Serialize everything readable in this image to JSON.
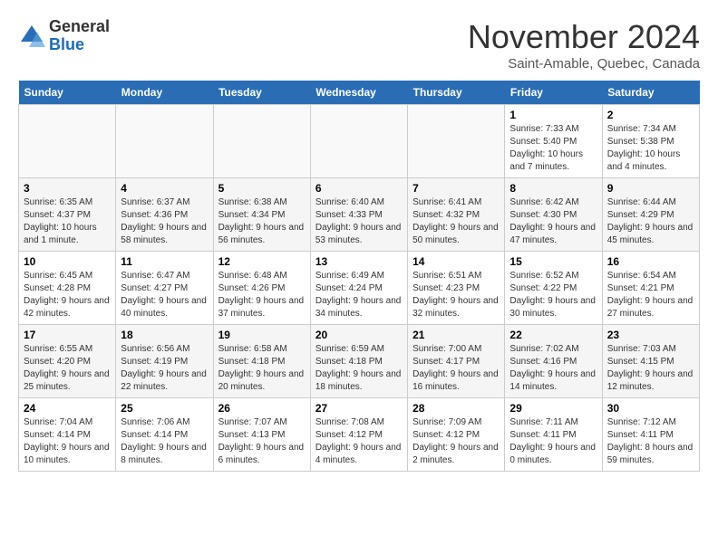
{
  "logo": {
    "line1": "General",
    "line2": "Blue"
  },
  "title": "November 2024",
  "subtitle": "Saint-Amable, Quebec, Canada",
  "weekdays": [
    "Sunday",
    "Monday",
    "Tuesday",
    "Wednesday",
    "Thursday",
    "Friday",
    "Saturday"
  ],
  "weeks": [
    [
      {
        "day": "",
        "info": ""
      },
      {
        "day": "",
        "info": ""
      },
      {
        "day": "",
        "info": ""
      },
      {
        "day": "",
        "info": ""
      },
      {
        "day": "",
        "info": ""
      },
      {
        "day": "1",
        "info": "Sunrise: 7:33 AM\nSunset: 5:40 PM\nDaylight: 10 hours and 7 minutes."
      },
      {
        "day": "2",
        "info": "Sunrise: 7:34 AM\nSunset: 5:38 PM\nDaylight: 10 hours and 4 minutes."
      }
    ],
    [
      {
        "day": "3",
        "info": "Sunrise: 6:35 AM\nSunset: 4:37 PM\nDaylight: 10 hours and 1 minute."
      },
      {
        "day": "4",
        "info": "Sunrise: 6:37 AM\nSunset: 4:36 PM\nDaylight: 9 hours and 58 minutes."
      },
      {
        "day": "5",
        "info": "Sunrise: 6:38 AM\nSunset: 4:34 PM\nDaylight: 9 hours and 56 minutes."
      },
      {
        "day": "6",
        "info": "Sunrise: 6:40 AM\nSunset: 4:33 PM\nDaylight: 9 hours and 53 minutes."
      },
      {
        "day": "7",
        "info": "Sunrise: 6:41 AM\nSunset: 4:32 PM\nDaylight: 9 hours and 50 minutes."
      },
      {
        "day": "8",
        "info": "Sunrise: 6:42 AM\nSunset: 4:30 PM\nDaylight: 9 hours and 47 minutes."
      },
      {
        "day": "9",
        "info": "Sunrise: 6:44 AM\nSunset: 4:29 PM\nDaylight: 9 hours and 45 minutes."
      }
    ],
    [
      {
        "day": "10",
        "info": "Sunrise: 6:45 AM\nSunset: 4:28 PM\nDaylight: 9 hours and 42 minutes."
      },
      {
        "day": "11",
        "info": "Sunrise: 6:47 AM\nSunset: 4:27 PM\nDaylight: 9 hours and 40 minutes."
      },
      {
        "day": "12",
        "info": "Sunrise: 6:48 AM\nSunset: 4:26 PM\nDaylight: 9 hours and 37 minutes."
      },
      {
        "day": "13",
        "info": "Sunrise: 6:49 AM\nSunset: 4:24 PM\nDaylight: 9 hours and 34 minutes."
      },
      {
        "day": "14",
        "info": "Sunrise: 6:51 AM\nSunset: 4:23 PM\nDaylight: 9 hours and 32 minutes."
      },
      {
        "day": "15",
        "info": "Sunrise: 6:52 AM\nSunset: 4:22 PM\nDaylight: 9 hours and 30 minutes."
      },
      {
        "day": "16",
        "info": "Sunrise: 6:54 AM\nSunset: 4:21 PM\nDaylight: 9 hours and 27 minutes."
      }
    ],
    [
      {
        "day": "17",
        "info": "Sunrise: 6:55 AM\nSunset: 4:20 PM\nDaylight: 9 hours and 25 minutes."
      },
      {
        "day": "18",
        "info": "Sunrise: 6:56 AM\nSunset: 4:19 PM\nDaylight: 9 hours and 22 minutes."
      },
      {
        "day": "19",
        "info": "Sunrise: 6:58 AM\nSunset: 4:18 PM\nDaylight: 9 hours and 20 minutes."
      },
      {
        "day": "20",
        "info": "Sunrise: 6:59 AM\nSunset: 4:18 PM\nDaylight: 9 hours and 18 minutes."
      },
      {
        "day": "21",
        "info": "Sunrise: 7:00 AM\nSunset: 4:17 PM\nDaylight: 9 hours and 16 minutes."
      },
      {
        "day": "22",
        "info": "Sunrise: 7:02 AM\nSunset: 4:16 PM\nDaylight: 9 hours and 14 minutes."
      },
      {
        "day": "23",
        "info": "Sunrise: 7:03 AM\nSunset: 4:15 PM\nDaylight: 9 hours and 12 minutes."
      }
    ],
    [
      {
        "day": "24",
        "info": "Sunrise: 7:04 AM\nSunset: 4:14 PM\nDaylight: 9 hours and 10 minutes."
      },
      {
        "day": "25",
        "info": "Sunrise: 7:06 AM\nSunset: 4:14 PM\nDaylight: 9 hours and 8 minutes."
      },
      {
        "day": "26",
        "info": "Sunrise: 7:07 AM\nSunset: 4:13 PM\nDaylight: 9 hours and 6 minutes."
      },
      {
        "day": "27",
        "info": "Sunrise: 7:08 AM\nSunset: 4:12 PM\nDaylight: 9 hours and 4 minutes."
      },
      {
        "day": "28",
        "info": "Sunrise: 7:09 AM\nSunset: 4:12 PM\nDaylight: 9 hours and 2 minutes."
      },
      {
        "day": "29",
        "info": "Sunrise: 7:11 AM\nSunset: 4:11 PM\nDaylight: 9 hours and 0 minutes."
      },
      {
        "day": "30",
        "info": "Sunrise: 7:12 AM\nSunset: 4:11 PM\nDaylight: 8 hours and 59 minutes."
      }
    ]
  ]
}
